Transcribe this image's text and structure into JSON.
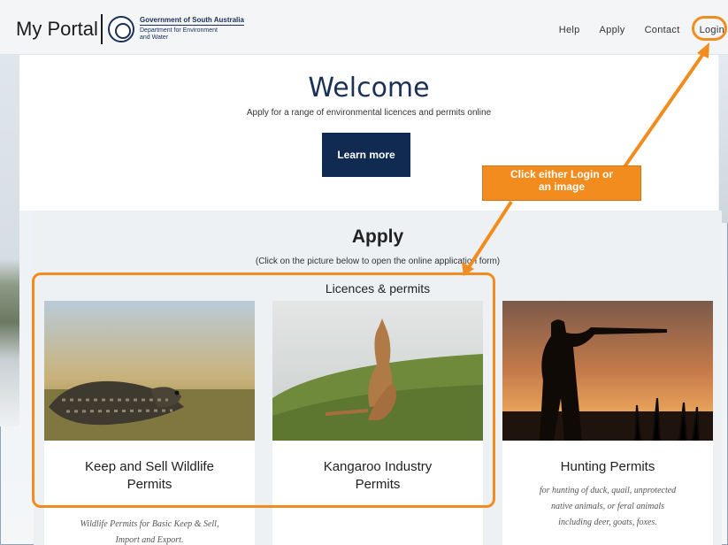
{
  "header": {
    "brand": "My Portal",
    "gov_title": "Government of South Australia",
    "gov_dept_line1": "Department for Environment",
    "gov_dept_line2": "and Water",
    "nav": [
      "Help",
      "Apply",
      "Contact",
      "Login"
    ]
  },
  "hero": {
    "title": "Welcome",
    "subtitle": "Apply for a range of environmental licences and permits online",
    "button": "Learn more"
  },
  "apply": {
    "title": "Apply",
    "subtitle": "(Click on the picture below to open the online application form)",
    "licences_heading": "Licences & permits",
    "cards": [
      {
        "title_line1": "Keep and Sell Wildlife",
        "title_line2": "Permits",
        "description_line1": "Wildlife Permits for Basic Keep & Sell,",
        "description_line2": "Import and Export."
      },
      {
        "title_line1": "Kangaroo Industry",
        "title_line2": "Permits"
      },
      {
        "title_line1": "Hunting Permits",
        "description_line1": "for hunting of duck, quail, unprotected",
        "description_line2": "native animals, or feral animals",
        "description_line3": "including deer, goats, foxes."
      }
    ]
  },
  "annotation": {
    "callout_line1": "Click either Login or",
    "callout_line2": "an image",
    "accent_color": "#f28c1f"
  },
  "colors": {
    "navy": "#102a52",
    "title_blue": "#1c3157"
  }
}
